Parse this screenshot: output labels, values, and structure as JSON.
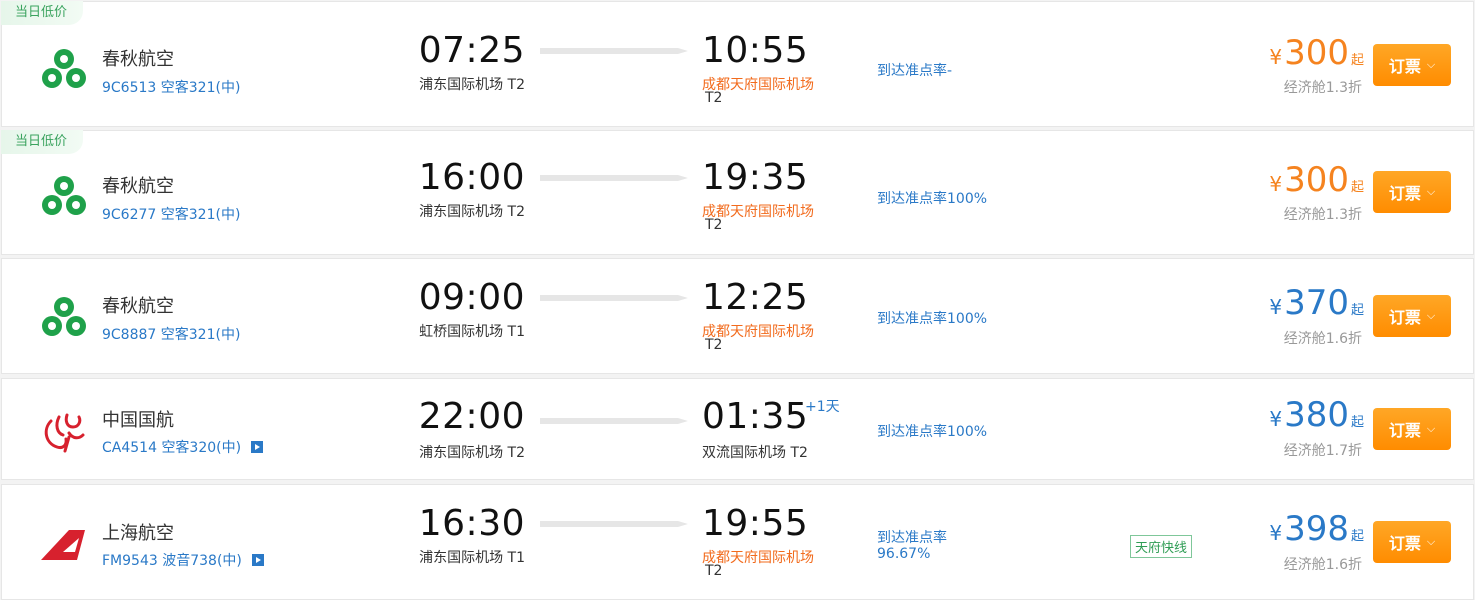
{
  "colors": {
    "accent_orange": "#f5831f",
    "accent_blue": "#2a79c7",
    "button_orange": "#ff9500",
    "badge_green": "#3aa35e"
  },
  "flights": [
    {
      "badge": "当日低价",
      "airline": "春秋航空",
      "logo_icon": "spring-airlines-logo-icon",
      "flight_no": "9C6513",
      "aircraft": "空客321(中)",
      "dep_time": "07:25",
      "dep_airport": "浦东国际机场 T2",
      "arr_time": "10:55",
      "arr_airport": "成都天府国际机场",
      "arr_terminal": "T2",
      "ontime": "到达准点率-",
      "price_symbol": "¥",
      "price": "300",
      "price_suffix": "起",
      "cabin": "经济舱1.3折",
      "book_label": "订票"
    },
    {
      "badge": "当日低价",
      "airline": "春秋航空",
      "logo_icon": "spring-airlines-logo-icon",
      "flight_no": "9C6277",
      "aircraft": "空客321(中)",
      "dep_time": "16:00",
      "dep_airport": "浦东国际机场 T2",
      "arr_time": "19:35",
      "arr_airport": "成都天府国际机场",
      "arr_terminal": "T2",
      "ontime": "到达准点率100%",
      "price_symbol": "¥",
      "price": "300",
      "price_suffix": "起",
      "cabin": "经济舱1.3折",
      "book_label": "订票"
    },
    {
      "airline": "春秋航空",
      "logo_icon": "spring-airlines-logo-icon",
      "flight_no": "9C8887",
      "aircraft": "空客321(中)",
      "dep_time": "09:00",
      "dep_airport": "虹桥国际机场 T1",
      "arr_time": "12:25",
      "arr_airport": "成都天府国际机场",
      "arr_terminal": "T2",
      "ontime": "到达准点率100%",
      "price_symbol": "¥",
      "price": "370",
      "price_suffix": "起",
      "cabin": "经济舱1.6折",
      "book_label": "订票"
    },
    {
      "airline": "中国国航",
      "logo_icon": "air-china-logo-icon",
      "flight_no": "CA4514",
      "aircraft": "空客320(中)",
      "dep_time": "22:00",
      "dep_airport": "浦东国际机场 T2",
      "arr_time": "01:35",
      "plus_day": "+1天",
      "arr_airport": "双流国际机场 T2",
      "ontime": "到达准点率100%",
      "price_symbol": "¥",
      "price": "380",
      "price_suffix": "起",
      "cabin": "经济舱1.7折",
      "book_label": "订票"
    },
    {
      "airline": "上海航空",
      "logo_icon": "shanghai-airlines-logo-icon",
      "flight_no": "FM9543",
      "aircraft": "波音738(中)",
      "dep_time": "16:30",
      "dep_airport": "浦东国际机场 T1",
      "arr_time": "19:55",
      "arr_airport": "成都天府国际机场",
      "arr_terminal": "T2",
      "ontime_line1": "到达准点率",
      "ontime_line2": "96.67%",
      "tag": "天府快线",
      "price_symbol": "¥",
      "price": "398",
      "price_suffix": "起",
      "cabin": "经济舱1.6折",
      "book_label": "订票"
    }
  ]
}
